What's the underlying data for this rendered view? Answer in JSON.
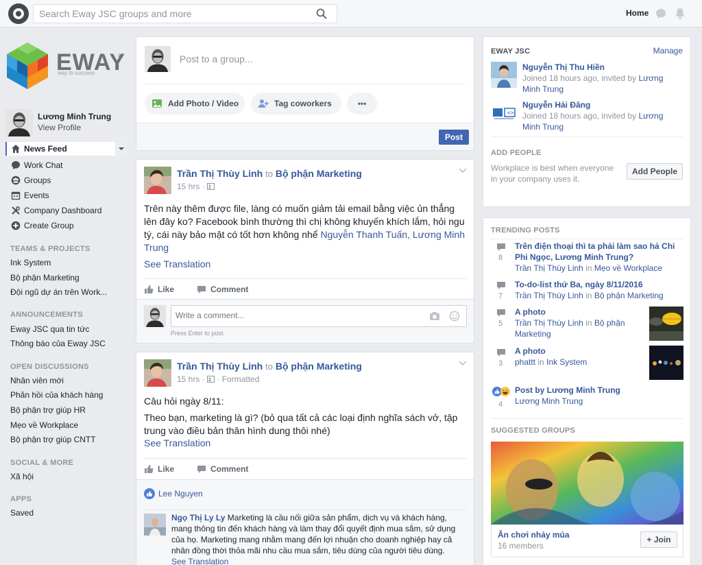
{
  "topbar": {
    "search_placeholder": "Search Eway JSC groups and more",
    "home_label": "Home"
  },
  "brand": {
    "name": "EWAY",
    "reg": "®",
    "tagline": "way to success"
  },
  "profile": {
    "name": "Lương Minh Trung",
    "view": "View Profile"
  },
  "nav": {
    "items": [
      {
        "label": "News Feed",
        "icon": "home-icon"
      },
      {
        "label": "Work Chat",
        "icon": "chat-icon"
      },
      {
        "label": "Groups",
        "icon": "groups-icon"
      },
      {
        "label": "Events",
        "icon": "calendar-icon"
      },
      {
        "label": "Company Dashboard",
        "icon": "dashboard-icon"
      },
      {
        "label": "Create Group",
        "icon": "plus-circle-icon"
      }
    ],
    "teams_header": "TEAMS & PROJECTS",
    "teams": [
      "Ink System",
      "Bộ phận Marketing",
      "Đội ngũ dự án trên Work..."
    ],
    "announcements_header": "ANNOUNCEMENTS",
    "announcements": [
      "Eway JSC qua tin tức",
      "Thông báo của Eway JSC"
    ],
    "open_header": "OPEN DISCUSSIONS",
    "open": [
      "Nhân viên mới",
      "Phản hồi của khách hàng",
      "Bộ phận trợ giúp HR",
      "Mẹo về Workplace",
      "Bộ phận trợ giúp CNTT"
    ],
    "social_header": "SOCIAL & MORE",
    "social": [
      "Xã hội"
    ],
    "apps_header": "APPS",
    "apps": [
      "Saved"
    ]
  },
  "composer": {
    "placeholder": "Post to a group...",
    "add_photo": "Add Photo / Video",
    "tag": "Tag coworkers",
    "more": "•••",
    "post": "Post"
  },
  "posts": [
    {
      "author": "Trần Thị Thùy Linh",
      "to": "to",
      "group": "Bộ phận Marketing",
      "time": "15 hrs",
      "extra": "",
      "body": "Trên này thêm được file, làng có muốn giảm tải email bằng việc ủn thẳng lên đây ko? Facebook bình thường thì chị không khuyến khích lắm, hỏi ngu tý, cái này bảo mật có tốt hơn không nhể ",
      "mention": "Nguyễn Thanh Tuấn, Lương Minh Trung",
      "see_translation": "See Translation",
      "like": "Like",
      "comment": "Comment",
      "comment_placeholder": "Write a comment...",
      "press_enter": "Press Enter to post."
    },
    {
      "author": "Trần Thị Thùy Linh",
      "to": "to",
      "group": "Bộ phận Marketing",
      "time": "15 hrs",
      "extra": "Formatted",
      "line1": "Câu hỏi ngày 8/11:",
      "body": "Theo bạn, marketing là gì? (bỏ qua tất cả các loại định nghĩa sách vở, tập trung vào điều bản thân hình dung thôi nhé)",
      "see_translation": "See Translation",
      "like": "Like",
      "comment": "Comment",
      "liker": "Lee Nguyen",
      "reply_author": "Ngọ Thị Ly Ly",
      "reply_text": "Marketing là cầu nối giữa sản phẩm, dịch vụ và khách hàng, mang thông tin đến khách hàng và làm thay đổi quyết định mua sắm, sử dụng của họ. Marketing mang nhằm mang đến lợi nhuận cho doanh nghiệp hay cả nhân đồng thời thỏa mãi nhu cầu mua sắm, tiêu dùng của người tiêu dùng.",
      "reply_translation": "See Translation"
    }
  ],
  "right": {
    "company": "EWAY JSC",
    "manage": "Manage",
    "members": [
      {
        "name": "Nguyễn Thị Thu Hiền",
        "joined": "Joined 18 hours ago, invited by ",
        "inviter": "Lương Minh Trung"
      },
      {
        "name": "Nguyễn Hải Đăng",
        "joined": "Joined 18 hours ago, invited by ",
        "inviter": "Lương Minh Trung"
      }
    ],
    "add_people_header": "ADD PEOPLE",
    "add_people_text": "Workplace is best when everyone in your company uses it.",
    "add_people_btn": "Add People",
    "trending_header": "TRENDING POSTS",
    "trending": [
      {
        "count": "8",
        "title": "Trên điện thoại thì ta phải làm sao hả Chi Phi Ngọc, Lương Minh Trung?",
        "author": "Trần Thị Thùy Linh",
        "in": "in",
        "group": "Mẹo về Workplace"
      },
      {
        "count": "7",
        "title": "To-do-list thứ Ba, ngày 8/11/2016",
        "author": "Trần Thị Thùy Linh",
        "in": "in",
        "group": "Bộ phận Marketing"
      },
      {
        "count": "5",
        "title": "A photo",
        "author": "Trần Thị Thùy Linh",
        "in": "in",
        "group": "Bộ phận Marketing"
      },
      {
        "count": "3",
        "title": "A photo",
        "author": "phattt",
        "in": "in",
        "group": "Ink System"
      },
      {
        "count": "4",
        "title": "Post by Lương Minh Trung",
        "author": "Lương Minh Trung",
        "in": "",
        "group": ""
      }
    ],
    "suggested_header": "SUGGESTED GROUPS",
    "suggested": {
      "name": "Ăn chơi nhảy múa",
      "members": "16 members",
      "join": "+ Join"
    }
  }
}
